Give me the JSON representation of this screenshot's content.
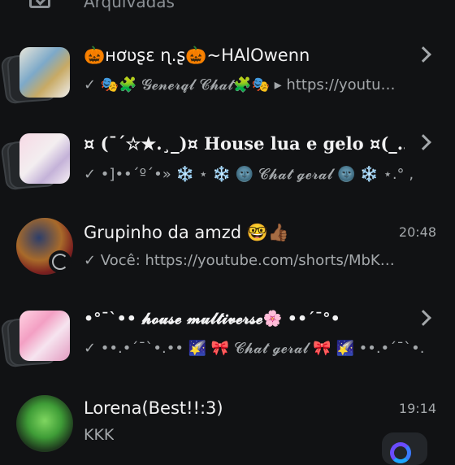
{
  "header": {
    "archived_label": "Arquivadas"
  },
  "chats": [
    {
      "name": "🎃ʜơʋʂɛ ɳ.ʂ🎃~HAlOwenn",
      "preview": "✓ 🎭🧩 𝓖𝓮𝓷𝓮𝓻𝓺𝓵 𝓒𝓱𝓪𝓽🧩🎭 ▸ https://youtu…"
    },
    {
      "name": "¤ (¯´☆★.¸_)¤ House lua e gelo ¤(_…",
      "preview": "✓ •]••´º´•» ❄️ ⋆ ❄️ 🌚 𝓒𝓱𝓪𝓽 𝓰𝓮𝓻𝓪𝓵 🌚 ❄️ ⋆.° ‚"
    },
    {
      "name": "Grupinho da amzd 🤓👍🏾",
      "preview": "✓ Você: https://youtube.com/shorts/MbK…",
      "time": "20:48"
    },
    {
      "name": "•°¯`•• 𝓱𝓸𝓾𝓼𝓮 𝓶𝓾𝓵𝓽𝓲𝓿𝓮𝓻𝓼𝓮🌸 ••´¯°•",
      "preview": "✓ ••.•´¯`•.•• 🌠 🎀 𝓒𝓱𝓪𝓽 𝓰𝓮𝓻𝓪𝓵 🎀 🌠 ••.•´¯`•.••"
    },
    {
      "name": "Lorena(Best!!:3)",
      "preview": "KKK",
      "time": "19:14"
    }
  ],
  "colors": {
    "background": "#111214",
    "text_primary": "#f1f1f2",
    "text_secondary": "#a4a8ab",
    "accent": "#6a4cff"
  },
  "icons": [
    "archive-icon",
    "chevron-right-icon",
    "status-ring-icon",
    "meta-ai-icon"
  ]
}
